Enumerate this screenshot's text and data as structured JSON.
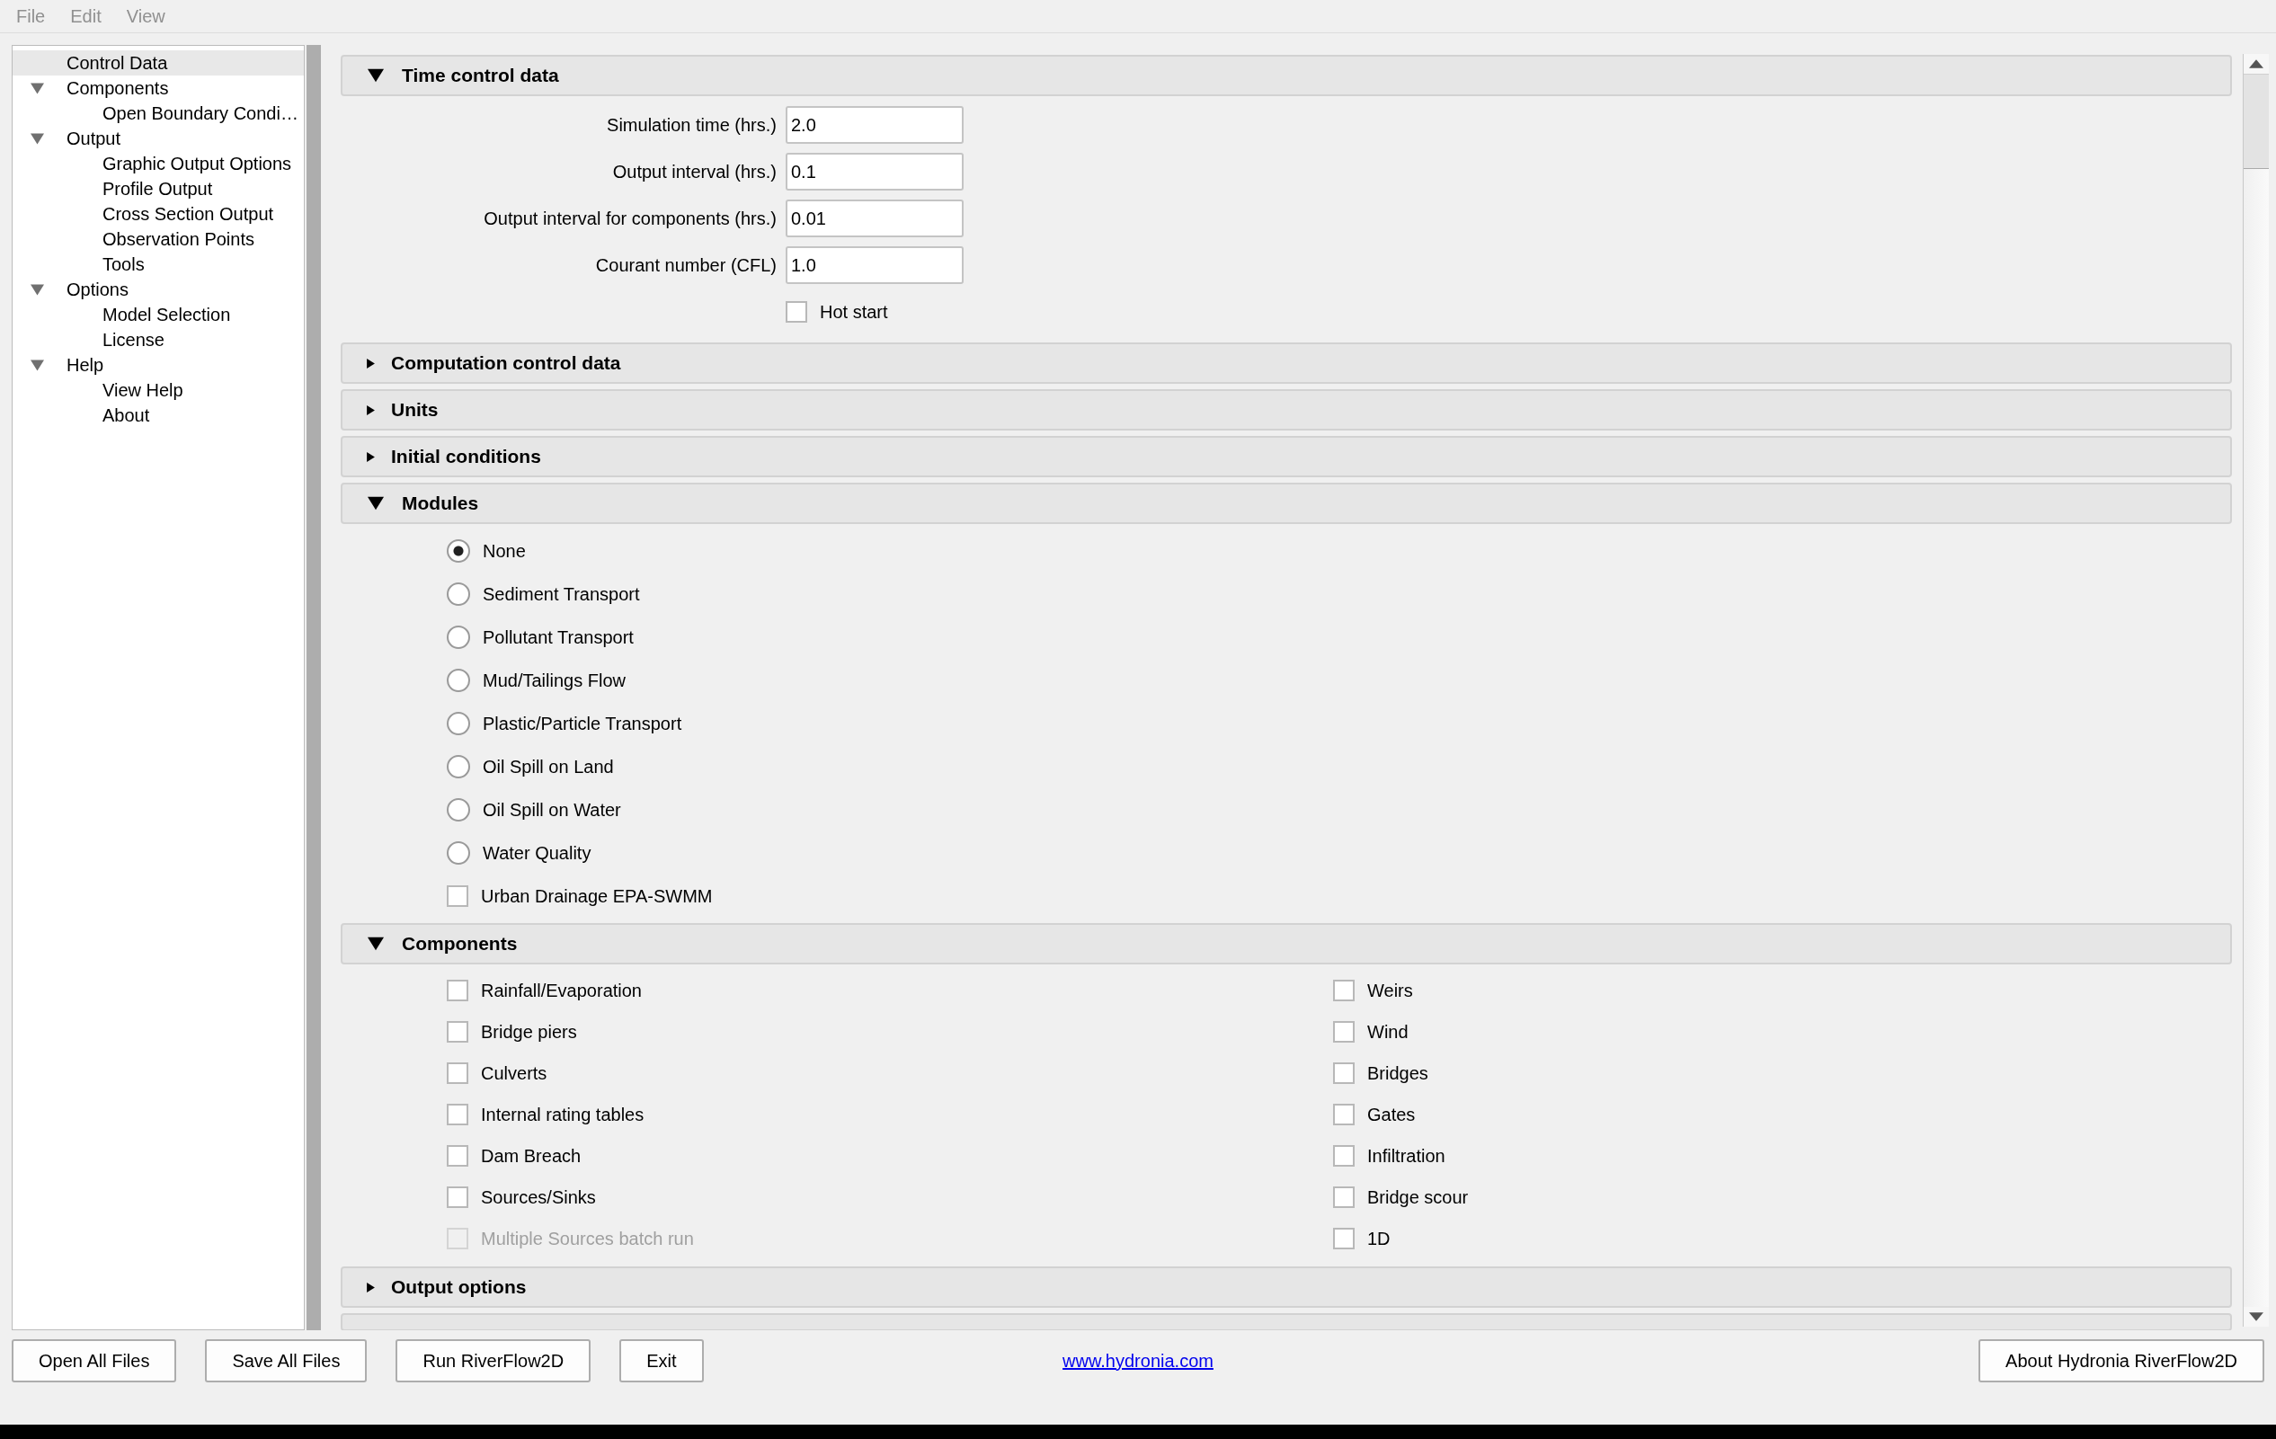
{
  "menu": [
    {
      "label": "File"
    },
    {
      "label": "Edit"
    },
    {
      "label": "View"
    }
  ],
  "sidebar": {
    "items": [
      {
        "label": "Control Data",
        "selected": true
      },
      {
        "label": "Components",
        "selected": false,
        "expanded": true,
        "children": [
          {
            "label": "Open Boundary Condi…",
            "selected": false
          }
        ]
      },
      {
        "label": "Output",
        "selected": false,
        "expanded": true,
        "children": [
          {
            "label": "Graphic Output Options",
            "selected": false
          },
          {
            "label": "Profile Output",
            "selected": false
          },
          {
            "label": "Cross Section Output",
            "selected": false
          },
          {
            "label": "Observation Points",
            "selected": false
          },
          {
            "label": "Tools",
            "selected": false
          }
        ]
      },
      {
        "label": "Options",
        "selected": false,
        "expanded": true,
        "children": [
          {
            "label": "Model Selection",
            "selected": false
          },
          {
            "label": "License",
            "selected": false
          }
        ]
      },
      {
        "label": "Help",
        "selected": false,
        "expanded": true,
        "children": [
          {
            "label": "View Help",
            "selected": false
          },
          {
            "label": "About",
            "selected": false
          }
        ]
      }
    ]
  },
  "sections": [
    {
      "kind": "fields",
      "title": "Time control data",
      "expanded": true,
      "fields": [
        {
          "label": "Simulation time (hrs.)",
          "value": "2.0"
        },
        {
          "label": "Output interval (hrs.)",
          "value": "0.1"
        },
        {
          "label": "Output interval for components (hrs.)",
          "value": "0.01"
        },
        {
          "label": "Courant number (CFL)",
          "value": "1.0"
        }
      ],
      "checkbox": {
        "label": "Hot start",
        "checked": false
      }
    },
    {
      "kind": "plain",
      "title": "Computation control data",
      "expanded": false
    },
    {
      "kind": "plain",
      "title": "Units",
      "expanded": false
    },
    {
      "kind": "plain",
      "title": "Initial conditions",
      "expanded": false
    },
    {
      "kind": "options",
      "title": "Modules",
      "expanded": true,
      "options": [
        {
          "kind": "radio",
          "label": "None",
          "selected": true
        },
        {
          "kind": "radio",
          "label": "Sediment Transport",
          "selected": false
        },
        {
          "kind": "radio",
          "label": "Pollutant Transport",
          "selected": false
        },
        {
          "kind": "radio",
          "label": "Mud/Tailings Flow",
          "selected": false
        },
        {
          "kind": "radio",
          "label": "Plastic/Particle Transport",
          "selected": false
        },
        {
          "kind": "radio",
          "label": "Oil Spill on Land",
          "selected": false
        },
        {
          "kind": "radio",
          "label": "Oil Spill on Water",
          "selected": false
        },
        {
          "kind": "radio",
          "label": "Water Quality",
          "selected": false
        },
        {
          "kind": "checkbox",
          "label": "Urban Drainage EPA-SWMM",
          "checked": false
        }
      ]
    },
    {
      "kind": "grid",
      "title": "Components",
      "expanded": true,
      "columns": [
        [
          {
            "label": "Rainfall/Evaporation",
            "checked": false,
            "disabled": false
          },
          {
            "label": "Bridge piers",
            "checked": false,
            "disabled": false
          },
          {
            "label": "Culverts",
            "checked": false,
            "disabled": false
          },
          {
            "label": "Internal rating tables",
            "checked": false,
            "disabled": false
          },
          {
            "label": "Dam Breach",
            "checked": false,
            "disabled": false
          },
          {
            "label": "Sources/Sinks",
            "checked": false,
            "disabled": false
          },
          {
            "label": "Multiple Sources batch run",
            "checked": false,
            "disabled": true
          }
        ],
        [
          {
            "label": "Weirs",
            "checked": false,
            "disabled": false
          },
          {
            "label": "Wind",
            "checked": false,
            "disabled": false
          },
          {
            "label": "Bridges",
            "checked": false,
            "disabled": false
          },
          {
            "label": "Gates",
            "checked": false,
            "disabled": false
          },
          {
            "label": "Infiltration",
            "checked": false,
            "disabled": false
          },
          {
            "label": "Bridge scour",
            "checked": false,
            "disabled": false
          },
          {
            "label": "1D",
            "checked": false,
            "disabled": false
          }
        ]
      ]
    },
    {
      "kind": "plain",
      "title": "Output options",
      "expanded": false
    },
    {
      "kind": "stub"
    }
  ],
  "footer": {
    "buttons": [
      {
        "label": "Open All Files"
      },
      {
        "label": "Save All Files"
      },
      {
        "label": "Run RiverFlow2D"
      },
      {
        "label": "Exit"
      }
    ],
    "link": "www.hydronia.com",
    "about_button": "About Hydronia RiverFlow2D"
  }
}
